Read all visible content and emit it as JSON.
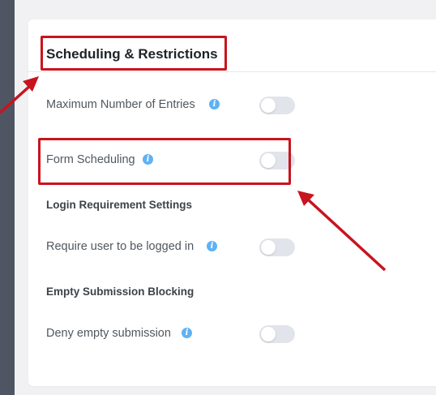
{
  "card": {
    "title": "Scheduling & Restrictions"
  },
  "settings": {
    "max_entries": {
      "label": "Maximum Number of Entries",
      "info_icon": "i",
      "enabled": false
    },
    "form_scheduling": {
      "label": "Form Scheduling",
      "info_icon": "i",
      "enabled": false
    },
    "login_section_heading": "Login Requirement Settings",
    "require_login": {
      "label": "Require user to be logged in",
      "info_icon": "i",
      "enabled": false
    },
    "empty_section_heading": "Empty Submission Blocking",
    "deny_empty": {
      "label": "Deny empty submission",
      "info_icon": "i",
      "enabled": false
    }
  },
  "colors": {
    "annotation_red": "#c8141e",
    "info_blue": "#5fb2f4",
    "toggle_off": "#e1e4ea",
    "sidebar": "#4f5563"
  },
  "icons": {
    "info": "info-icon",
    "annotation": "annotation-arrow"
  }
}
